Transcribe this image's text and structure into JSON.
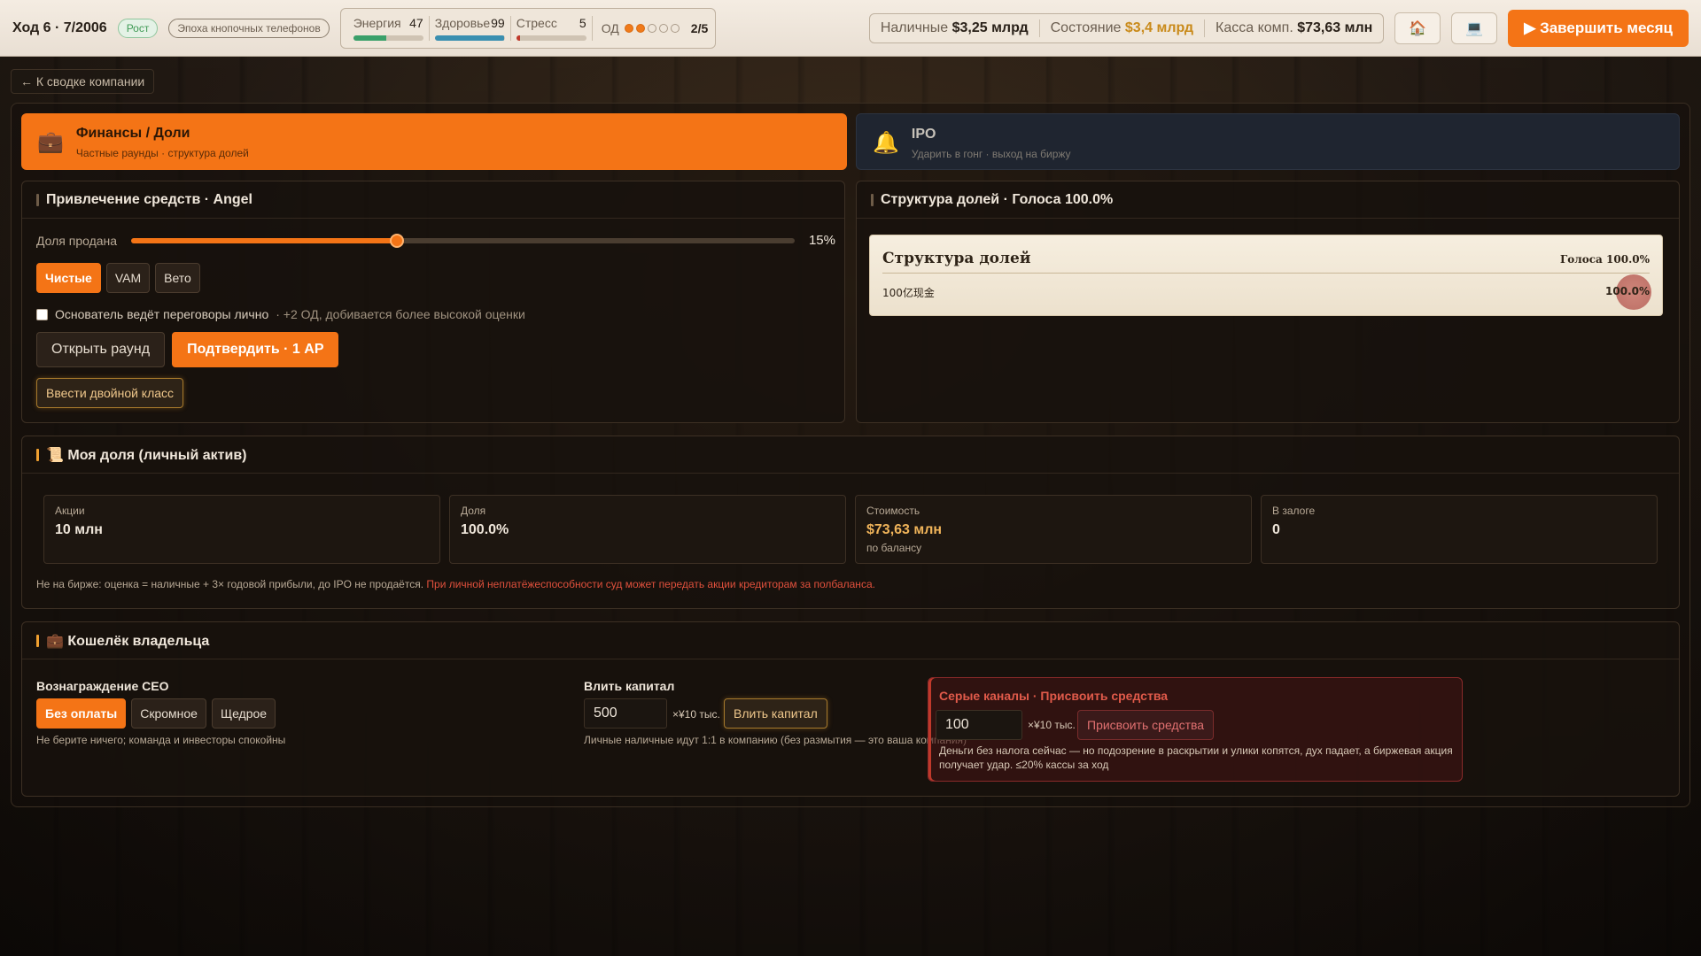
{
  "topbar": {
    "turn": "Ход 6 · 7/2006",
    "phase_badge": "Рост",
    "era_badge": "Эпоха кнопочных телефонов",
    "stats": [
      {
        "label": "Энергия",
        "value": "47",
        "fill": 0.47,
        "color": "#3aa06a"
      },
      {
        "label": "Здоровье",
        "value": "99",
        "fill": 0.99,
        "color": "#3a8fb0"
      },
      {
        "label": "Стресс",
        "value": "5",
        "fill": 0.05,
        "color": "#c0392b"
      }
    ],
    "ap": {
      "label": "ОД",
      "filled": 2,
      "total": 5,
      "text": "2/5"
    },
    "cash_label": "Наличные",
    "cash_value": "$3,25 млрд",
    "networth_label": "Состояние",
    "networth_value": "$3,4 млрд",
    "company_cash_label": "Касса комп.",
    "company_cash_value": "$73,63 млн",
    "home_icon": "🏠",
    "computer_icon": "💻",
    "end_month": "▶ Завершить месяц"
  },
  "back_link": "← К сводке компании",
  "tabs": [
    {
      "icon": "💼",
      "title": "Финансы / Доли",
      "subtitle": "Частные раунды · структура долей"
    },
    {
      "icon": "🔔",
      "title": "IPO",
      "subtitle": "Ударить в гонг · выход на биржу"
    }
  ],
  "raise": {
    "title": "Привлечение средств · Angel",
    "slider_label": "Доля продана",
    "slider_value": "15%",
    "slider_fill": 0.4,
    "types": [
      "Чистые",
      "VAM",
      "Вето"
    ],
    "checkbox_label": "Основатель ведёт переговоры лично",
    "checkbox_note": " · +2 ОД, добивается более высокой оценки",
    "open_round": "Открыть раунд",
    "confirm": "Подтвердить · 1 АР",
    "dual_class": "Ввести двойной класс"
  },
  "cap_table": {
    "title": "Структура долей · Голоса 100.0%",
    "sheet_title": "Структура долей",
    "sheet_votes": "Голоса 100.0%",
    "holder": "100亿现金",
    "holder_share": "100.0%"
  },
  "my_stake": {
    "title": "📜 Моя доля (личный актив)",
    "cards": [
      {
        "label": "Акции",
        "value": "10 млн",
        "sub": ""
      },
      {
        "label": "Доля",
        "value": "100.0%",
        "sub": ""
      },
      {
        "label": "Стоимость",
        "value": "$73,63 млн",
        "sub": "по балансу"
      },
      {
        "label": "В залоге",
        "value": "0",
        "sub": ""
      }
    ],
    "note": "Не на бирже: оценка = наличные + 3× годовой прибыли, до IPO не продаётся. ",
    "warning": "При личной неплатёжеспособности суд может передать акции кредиторам за полбаланса."
  },
  "wallet": {
    "title": "💼 Кошелёк владельца",
    "ceo_label": "Вознаграждение CEO",
    "ceo_options": [
      "Без оплаты",
      "Скромное",
      "Щедрое"
    ],
    "ceo_note": "Не берите ничего; команда и инвесторы спокойны",
    "inject_label": "Влить капитал",
    "inject_value": "500",
    "inject_unit": "×¥10 тыс.",
    "inject_button": "Влить капитал",
    "inject_note": "Личные наличные идут 1:1 в компанию (без размытия — это ваша компания)",
    "grey_title": "Серые каналы · Присвоить средства",
    "grey_value": "100",
    "grey_unit": "×¥10 тыс.",
    "grey_button": "Присвоить средства",
    "grey_note": "Деньги без налога сейчас — но подозрение в раскрытии и улики копятся, дух падает, а биржевая акция получает удар. ≤20% кассы за ход"
  }
}
